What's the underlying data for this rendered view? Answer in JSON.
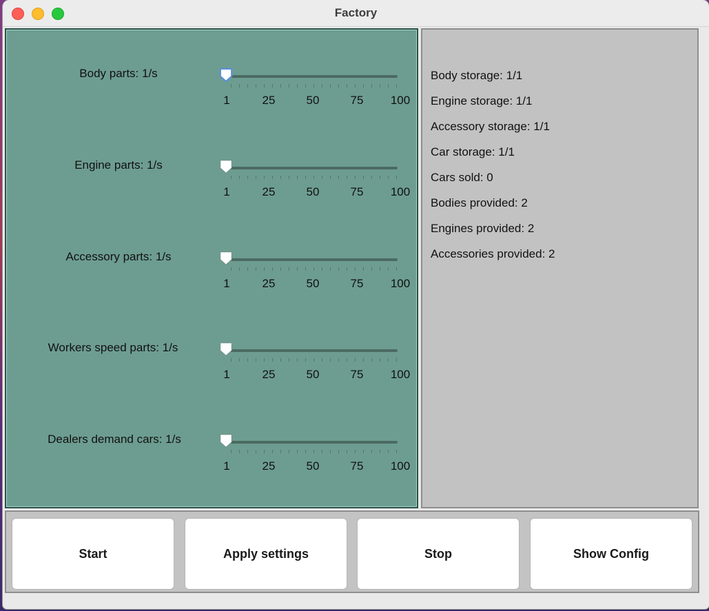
{
  "window": {
    "title": "Factory"
  },
  "controls": {
    "sliders": [
      {
        "label": "Body parts: 1/s",
        "value": 1,
        "focused": true
      },
      {
        "label": "Engine parts: 1/s",
        "value": 1,
        "focused": false
      },
      {
        "label": "Accessory parts: 1/s",
        "value": 1,
        "focused": false
      },
      {
        "label": "Workers speed parts: 1/s",
        "value": 1,
        "focused": false
      },
      {
        "label": "Dealers demand cars: 1/s",
        "value": 1,
        "focused": false
      }
    ],
    "tick_labels": [
      "1",
      "25",
      "50",
      "75",
      "100"
    ],
    "min": 1,
    "max": 100
  },
  "stats": [
    "Body storage: 1/1",
    "Engine storage: 1/1",
    "Accessory storage: 1/1",
    "Car storage: 1/1",
    "Cars sold: 0",
    "Bodies provided: 2",
    "Engines provided: 2",
    "Accessories provided: 2"
  ],
  "buttons": {
    "start": "Start",
    "apply": "Apply settings",
    "stop": "Stop",
    "show_config": "Show Config"
  },
  "colors": {
    "left_panel": "#6d9d90",
    "right_panel": "#c2c2c2",
    "focus_ring": "#5b8fd6"
  }
}
